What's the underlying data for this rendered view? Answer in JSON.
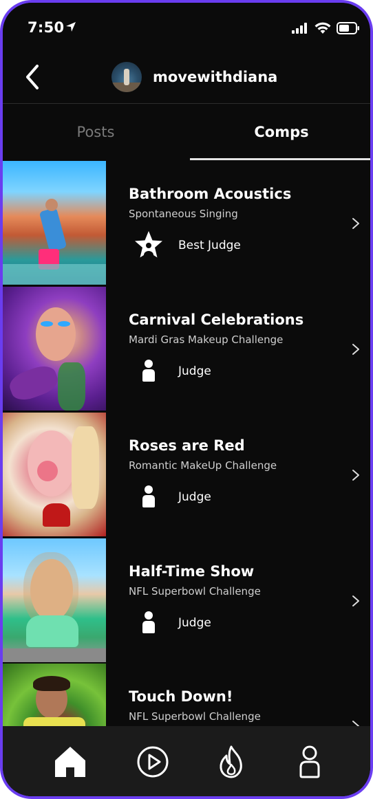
{
  "status_bar": {
    "time": "7:50"
  },
  "header": {
    "username": "movewithdiana"
  },
  "tabs": [
    {
      "label": "Posts",
      "active": false
    },
    {
      "label": "Comps",
      "active": true
    }
  ],
  "comps": [
    {
      "title": "Bathroom Acoustics",
      "subtitle": "Spontaneous Singing",
      "role": "Best Judge",
      "role_icon": "star-judge-icon"
    },
    {
      "title": "Carnival Celebrations",
      "subtitle": "Mardi Gras Makeup Challenge",
      "role": "Judge",
      "role_icon": "person-icon"
    },
    {
      "title": "Roses are Red",
      "subtitle": "Romantic MakeUp Challenge",
      "role": "Judge",
      "role_icon": "person-icon"
    },
    {
      "title": "Half-Time Show",
      "subtitle": "NFL Superbowl Challenge",
      "role": "Judge",
      "role_icon": "person-icon"
    },
    {
      "title": "Touch Down!",
      "subtitle": "NFL Superbowl Challenge",
      "role": "",
      "role_icon": ""
    }
  ],
  "bottom_nav": [
    "home-icon",
    "play-icon",
    "flame-icon",
    "profile-icon"
  ],
  "colors": {
    "frame": "#6a3df0",
    "background": "#0b0b0b",
    "nav_background": "#1b1b1b"
  }
}
